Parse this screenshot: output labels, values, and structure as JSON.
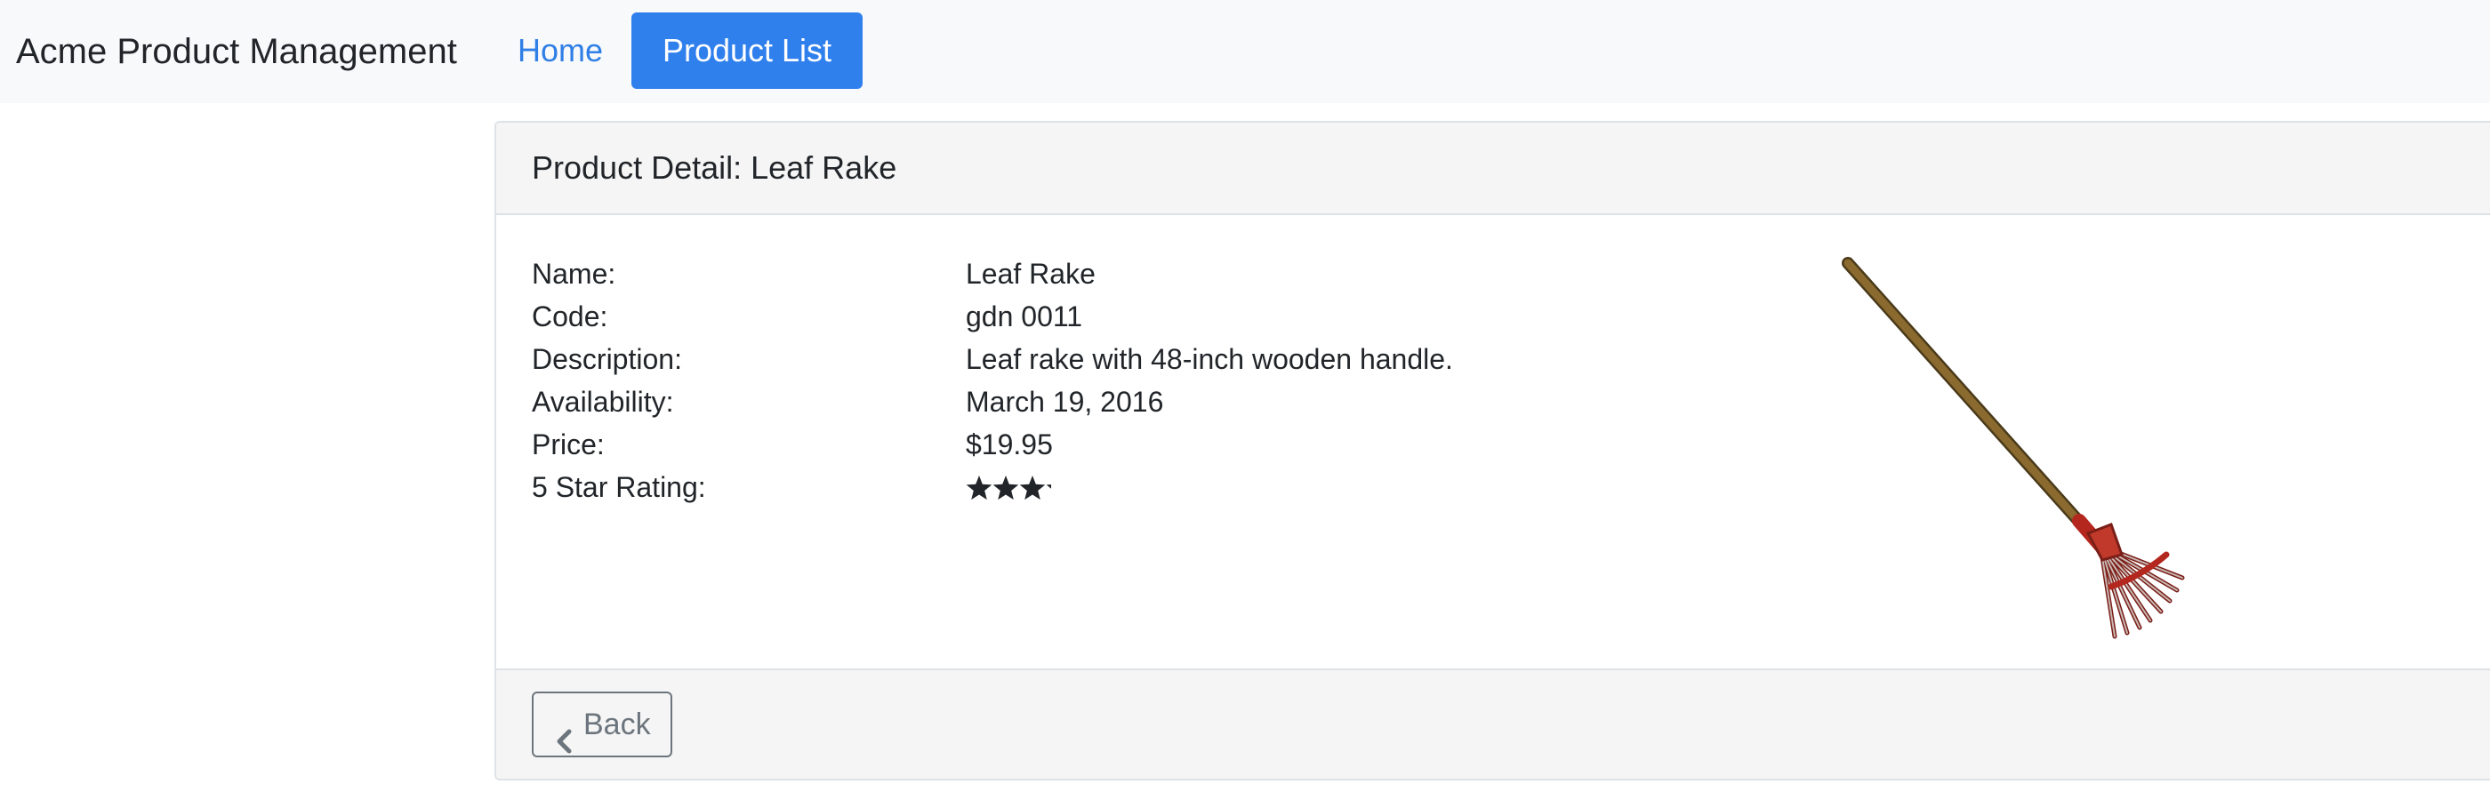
{
  "navbar": {
    "brand": "Acme Product Management",
    "links": [
      {
        "label": "Home",
        "active": false
      },
      {
        "label": "Product List",
        "active": true
      }
    ]
  },
  "card": {
    "title": "Product Detail: Leaf Rake",
    "details": [
      {
        "label": "Name:",
        "value": "Leaf Rake"
      },
      {
        "label": "Code:",
        "value": "gdn 0011"
      },
      {
        "label": "Description:",
        "value": "Leaf rake with 48-inch wooden handle."
      },
      {
        "label": "Availability:",
        "value": "March 19, 2016"
      },
      {
        "label": "Price:",
        "value": "$19.95"
      },
      {
        "label": "5 Star Rating:",
        "value": ""
      }
    ],
    "rating": {
      "value": 3.2,
      "max": 5
    },
    "image": {
      "icon": "leaf-rake-image"
    },
    "footer": {
      "back_label": "Back",
      "back_icon": "chevron-left-icon"
    }
  },
  "colors": {
    "primary": "#2f80ed",
    "link": "#2f7fe6",
    "navbar_bg": "#f8f9fa",
    "header_bg": "#f5f5f5",
    "secondary": "#6c757d",
    "star": "#212529"
  }
}
